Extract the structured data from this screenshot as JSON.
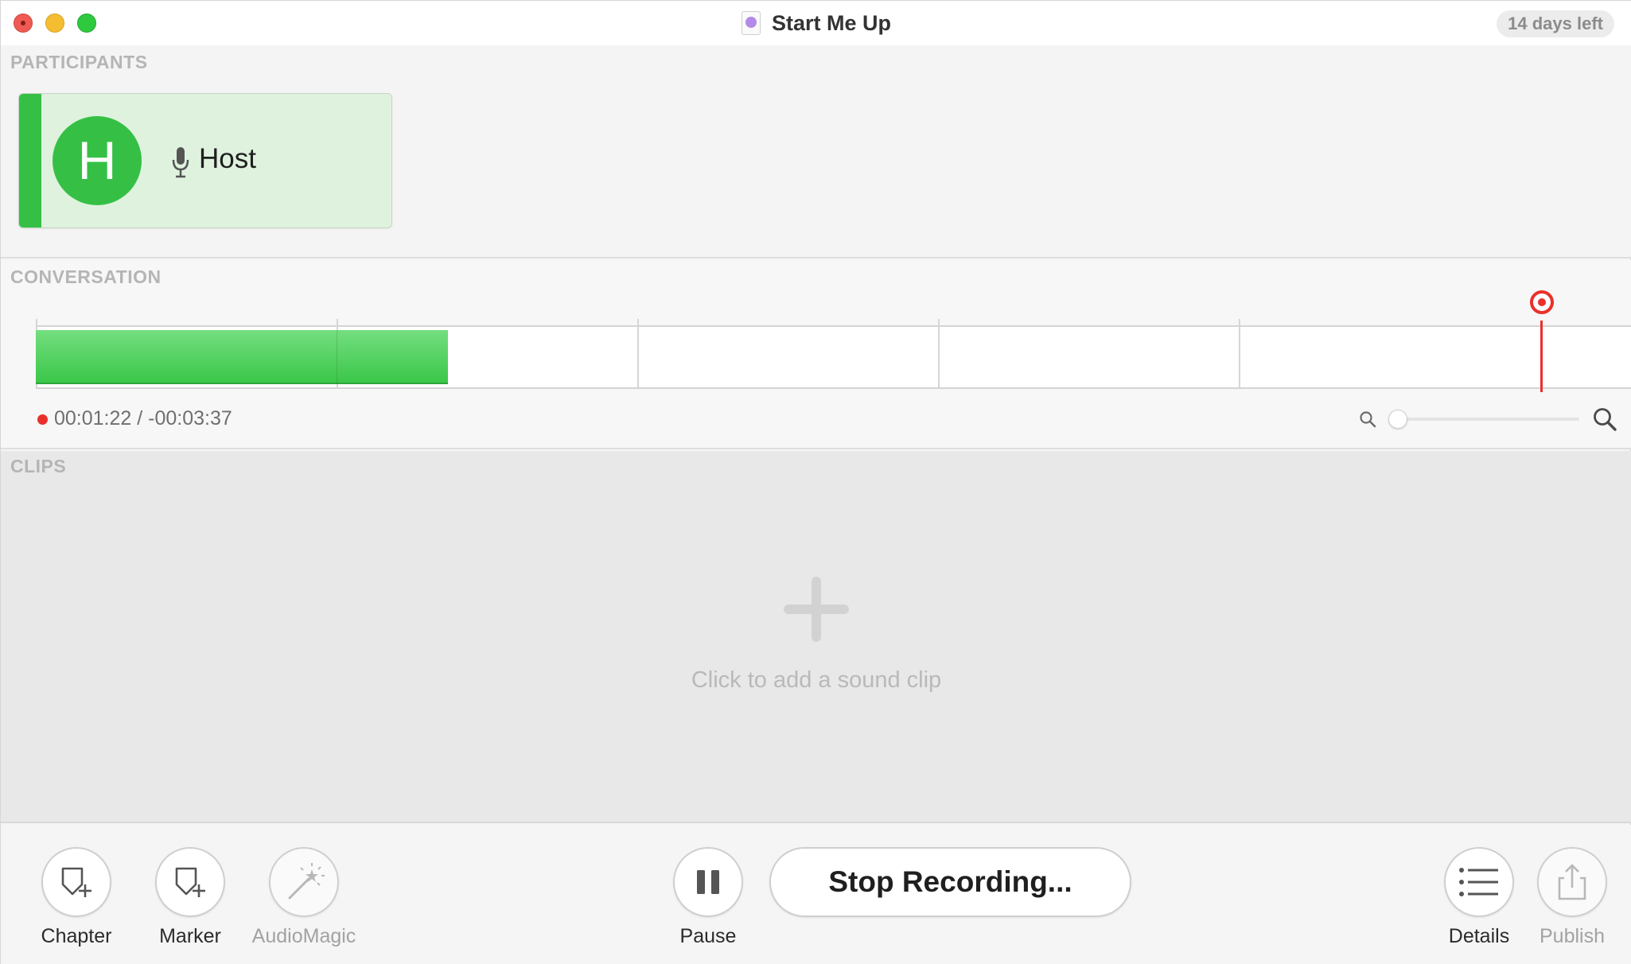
{
  "window": {
    "title": "Start Me Up",
    "trial_badge": "14 days left"
  },
  "participants": {
    "section_label": "PARTICIPANTS",
    "items": [
      {
        "initial": "H",
        "name": "Host",
        "color": "#35c045"
      }
    ]
  },
  "conversation": {
    "section_label": "CONVERSATION",
    "elapsed": "00:01:22",
    "separator": " / ",
    "remaining": "-00:03:37"
  },
  "clips": {
    "section_label": "CLIPS",
    "empty_hint": "Click to add a sound clip"
  },
  "toolbar": {
    "chapter_label": "Chapter",
    "marker_label": "Marker",
    "audiomagic_label": "AudioMagic",
    "pause_label": "Pause",
    "stop_label": "Stop Recording...",
    "details_label": "Details",
    "publish_label": "Publish"
  },
  "colors": {
    "accent_green": "#35c045",
    "record_red": "#e9302c"
  },
  "icons": [
    "close-icon",
    "minimize-icon",
    "maximize-icon",
    "document-icon",
    "microphone-icon",
    "zoom-out-icon",
    "zoom-in-icon",
    "plus-icon",
    "chapter-add-icon",
    "marker-add-icon",
    "magic-wand-icon",
    "pause-icon",
    "list-icon",
    "share-icon"
  ]
}
